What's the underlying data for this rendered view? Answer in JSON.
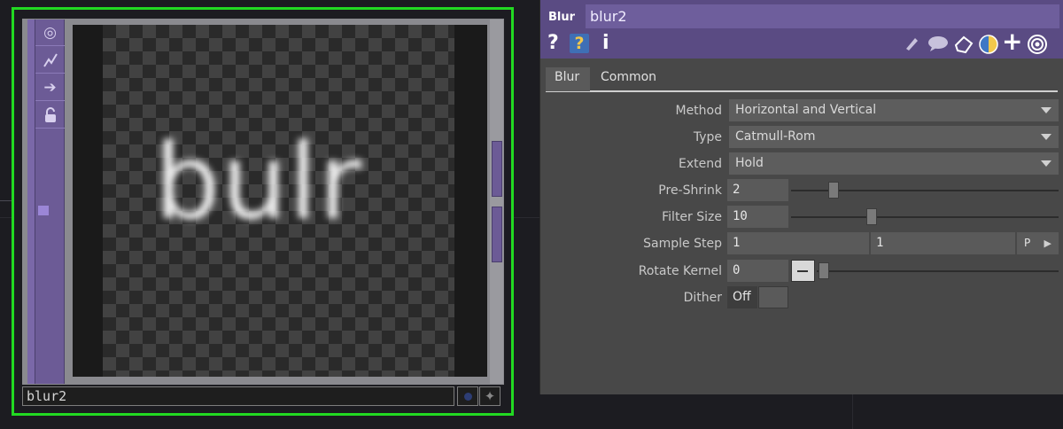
{
  "node": {
    "name": "blur2",
    "viewer_text": "bulr",
    "sidebar_icons": [
      "viewer-active-icon",
      "bypass-icon",
      "arrow-right-icon",
      "lock-icon"
    ]
  },
  "panel": {
    "op_type": "Blur",
    "op_name": "blur2",
    "header_icons_left": [
      "help-icon",
      "python-help-icon",
      "info-icon"
    ],
    "header_icons_right": [
      "edit-icon",
      "comment-icon",
      "clone-icon",
      "python-icon",
      "add-icon",
      "target-icon"
    ],
    "tabs": [
      {
        "label": "Blur",
        "active": true
      },
      {
        "label": "Common",
        "active": false
      }
    ],
    "params": {
      "method": {
        "label": "Method",
        "value": "Horizontal and Vertical"
      },
      "type": {
        "label": "Type",
        "value": "Catmull-Rom"
      },
      "extend": {
        "label": "Extend",
        "value": "Hold"
      },
      "preshrink": {
        "label": "Pre-Shrink",
        "value": "2"
      },
      "filtersize": {
        "label": "Filter Size",
        "value": "10"
      },
      "samplestep": {
        "label": "Sample Step",
        "value1": "1",
        "value2": "1",
        "p_button": "P"
      },
      "rotatekernel": {
        "label": "Rotate Kernel",
        "value": "0"
      },
      "dither": {
        "label": "Dither",
        "value": "Off"
      }
    }
  }
}
